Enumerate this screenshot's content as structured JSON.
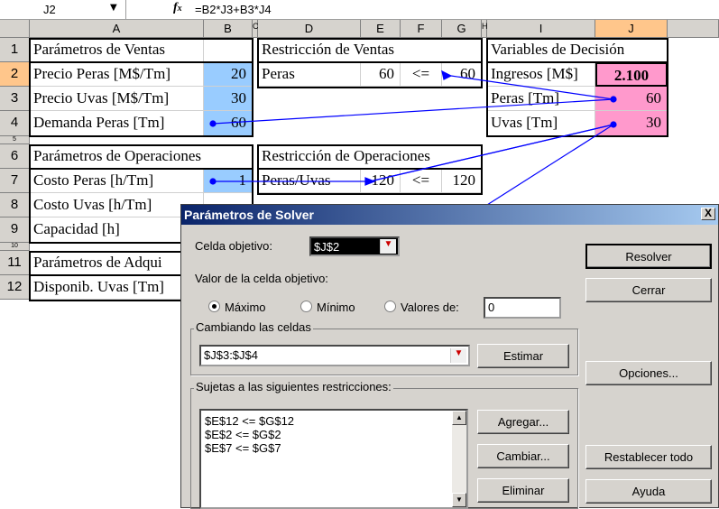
{
  "formula_bar": {
    "name_box": "J2",
    "fx": "fx",
    "formula": "=B2*J3+B3*J4"
  },
  "columns": [
    "A",
    "B",
    "C",
    "D",
    "E",
    "F",
    "G",
    "H",
    "I",
    "J"
  ],
  "rows": [
    "1",
    "2",
    "3",
    "4",
    "5",
    "6",
    "7",
    "8",
    "9",
    "10",
    "11",
    "12"
  ],
  "cells": {
    "A1": "Parámetros de Ventas",
    "A2": "Precio Peras [M$/Tm]",
    "B2": "20",
    "A3": "Precio Uvas [M$/Tm]",
    "B3": "30",
    "A4": "Demanda Peras [Tm]",
    "B4": "60",
    "A6": "Parámetros de Operaciones",
    "A7": "Costo Peras [h/Tm]",
    "B7": "1",
    "A8": "Costo Uvas [h/Tm]",
    "A9": "Capacidad [h]",
    "A11": "Parámetros de Adqui",
    "A12": "Disponib. Uvas [Tm]",
    "D1": "Restricción de Ventas",
    "D2": "Peras",
    "E2": "60",
    "F2": "<=",
    "G2": "60",
    "D6": "Restricción de Operaciones",
    "D7": "Peras/Uvas",
    "E7": "120",
    "F7": "<=",
    "G7": "120",
    "I1": "Variables de Decisión",
    "I2": "Ingresos [M$]",
    "J2": "2.100",
    "I3": "Peras [Tm]",
    "J3": "60",
    "I4": "Uvas [Tm]",
    "J4": "30"
  },
  "colors": {
    "input_blue": "#99ccff",
    "output_pink": "#ff99cc",
    "arrow": "#0000ff"
  },
  "dialog": {
    "title": "Parámetros de Solver",
    "close_label": "X",
    "target_label": "Celda objetivo:",
    "target_value": "$J$2",
    "value_label": "Valor de la celda objetivo:",
    "radio_max": "Máximo",
    "radio_min": "Mínimo",
    "radio_values": "Valores de:",
    "values_input": "0",
    "changing_label": "Cambiando las celdas",
    "changing_value": "$J$3:$J$4",
    "estimate_button": "Estimar",
    "constraints_label": "Sujetas a las siguientes restricciones:",
    "constraints": [
      "$E$12 <= $G$12",
      "$E$2 <= $G$2",
      "$E$7 <= $G$7"
    ],
    "add_button": "Agregar...",
    "change_button": "Cambiar...",
    "delete_button": "Eliminar",
    "solve_button": "Resolver",
    "close_button": "Cerrar",
    "options_button": "Opciones...",
    "reset_button": "Restablecer todo",
    "help_button": "Ayuda"
  }
}
